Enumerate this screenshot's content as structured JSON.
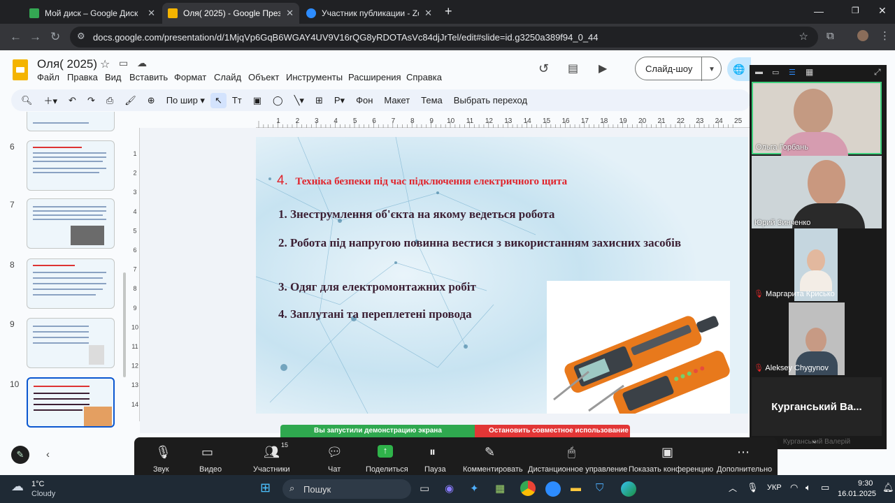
{
  "browser": {
    "tabs": [
      {
        "title": "Мой диск – Google Диск",
        "color": "#34a853"
      },
      {
        "title": "Оля( 2025) - Google Презентации",
        "color": "#f4b400"
      },
      {
        "title": "Участник публикации - Zoom",
        "color": "#2d8cff"
      }
    ],
    "url": "docs.google.com/presentation/d/1MjqVp6GqB6WGAY4UV9V16rQG8yRDOTAsVc84djJrTel/edit#slide=id.g3250a389f94_0_44"
  },
  "docs": {
    "title": "Оля( 2025)",
    "menu": [
      "Файл",
      "Правка",
      "Вид",
      "Вставить",
      "Формат",
      "Слайд",
      "Объект",
      "Инструменты",
      "Расширения",
      "Справка"
    ],
    "toolbar": {
      "zoom_label": "По шир",
      "background": "Фон",
      "layout": "Макет",
      "theme": "Тема",
      "transition": "Выбрать переход"
    },
    "slideshow_label": "Слайд-шоу"
  },
  "filmstrip": {
    "numbers": [
      "6",
      "7",
      "8",
      "9",
      "10"
    ]
  },
  "ruler": {
    "ticks": [
      "1",
      "2",
      "3",
      "4",
      "5",
      "6",
      "7",
      "8",
      "9",
      "10",
      "11",
      "12",
      "13",
      "14",
      "15",
      "16",
      "17",
      "18",
      "19",
      "20",
      "21",
      "22",
      "23",
      "24",
      "25"
    ],
    "vticks": [
      "1",
      "2",
      "3",
      "4",
      "5",
      "6",
      "7",
      "8",
      "9",
      "10",
      "11",
      "12",
      "13",
      "14"
    ]
  },
  "slide": {
    "heading_num": "4.",
    "heading": "Техніка безпеки під час підключення електричного щита",
    "items": [
      "1. Знеструмлення об'єкта на якому ведеться робота",
      "2. Робота під напругою повинна вестися з використанням захисних засобів",
      "3. Одяг для електромонтажних робіт",
      "4. Заплутані та переплетені провода"
    ]
  },
  "zoom": {
    "participants": [
      {
        "name": "Ольга Горбань"
      },
      {
        "name": "Юрий Зинченко"
      },
      {
        "name": "Маргарита Крисько"
      },
      {
        "name": "Aleksey Chygynov"
      }
    ],
    "big_name": "Курганський Ва...",
    "scroll_name": "Курганський Валерій",
    "controls": [
      "Звук",
      "Видео",
      "Участники",
      "Чат",
      "Поделиться",
      "Пауза",
      "Комментировать",
      "Дистанционное управление",
      "Показать конференцию",
      "Дополнительно"
    ],
    "participants_count": "15",
    "share_notice": "Вы запустили демонстрацию экрана",
    "stop_share": "Остановить совместное использование"
  },
  "taskbar": {
    "weather_temp": "1°C",
    "weather_desc": "Cloudy",
    "search": "Пошук",
    "lang": "УКР",
    "time": "9:30",
    "date": "16.01.2025"
  }
}
